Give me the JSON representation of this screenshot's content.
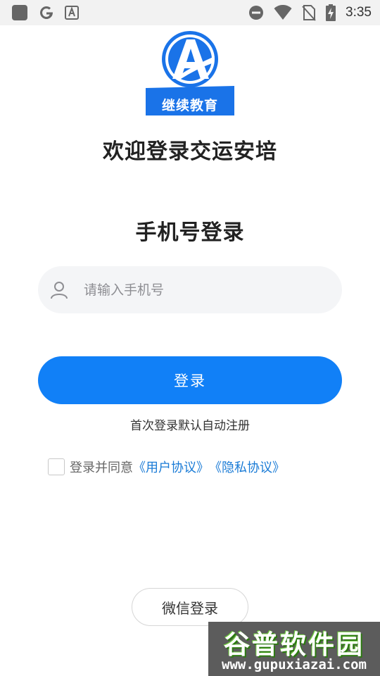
{
  "status_bar": {
    "time": "3:35",
    "left_icons": [
      "app-square-icon",
      "google-icon",
      "font-a-icon"
    ],
    "right_icons": [
      "do-not-disturb-icon",
      "wifi-icon",
      "no-sim-icon",
      "battery-charging-icon"
    ]
  },
  "logo": {
    "text": "继续教育",
    "brand_color": "#1a73e8"
  },
  "welcome_title": "欢迎登录交运安培",
  "section_title": "手机号登录",
  "phone_input": {
    "placeholder": "请输入手机号",
    "value": "",
    "icon": "user-icon"
  },
  "login_button": {
    "label": "登录",
    "color": "#1180f7"
  },
  "auto_register_note": "首次登录默认自动注册",
  "agreement": {
    "checked": false,
    "prefix": "登录并同意",
    "user_agreement": "《用户协议》",
    "privacy_policy": "《隐私协议》",
    "link_color": "#1a7bd6"
  },
  "wechat_button": {
    "label": "微信登录"
  },
  "watermark": {
    "title": "谷普软件园",
    "url": "www.gupuxiazai.com"
  }
}
